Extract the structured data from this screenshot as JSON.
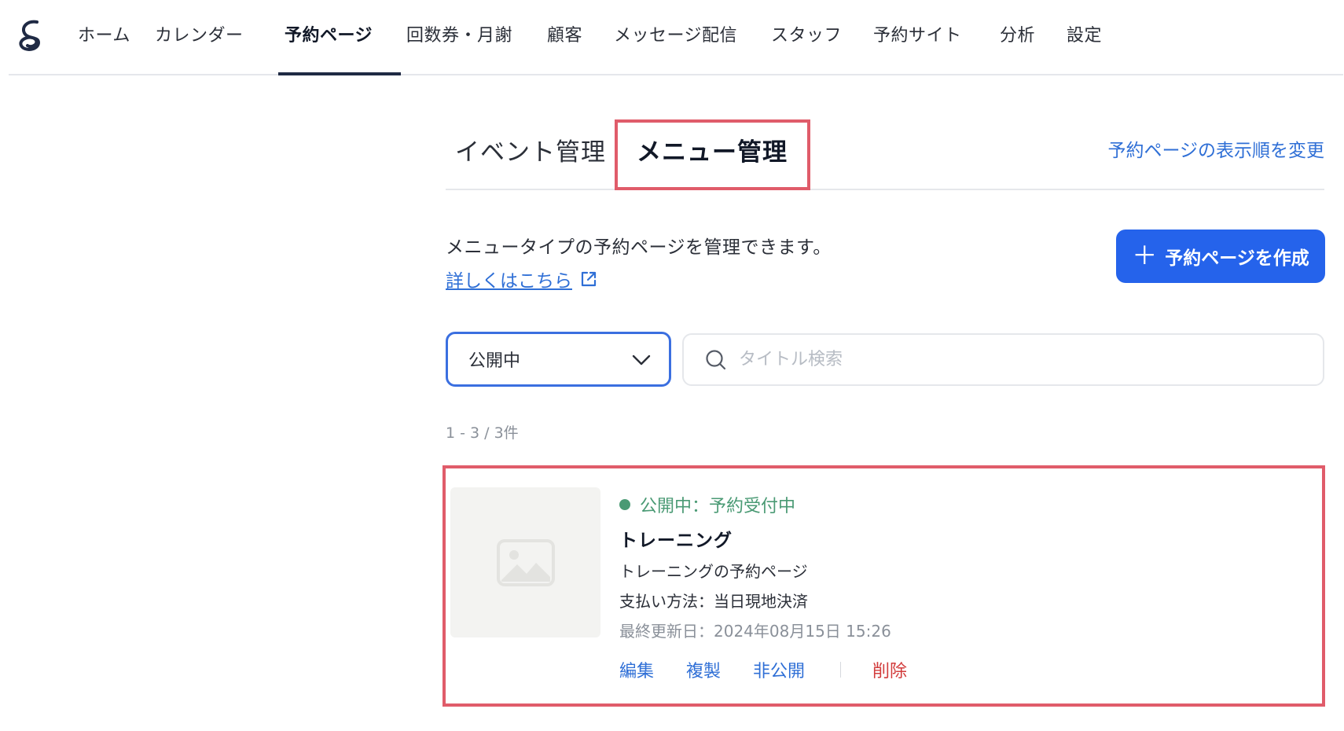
{
  "nav": {
    "items": [
      {
        "label": "ホーム"
      },
      {
        "label": "カレンダー"
      },
      {
        "label": "予約ページ",
        "active": true
      },
      {
        "label": "回数券・月謝"
      },
      {
        "label": "顧客"
      },
      {
        "label": "メッセージ配信"
      },
      {
        "label": "スタッフ"
      },
      {
        "label": "予約サイト"
      },
      {
        "label": "分析"
      },
      {
        "label": "設定"
      }
    ]
  },
  "subtabs": {
    "event": "イベント管理",
    "menu": "メニュー管理",
    "sort_link": "予約ページの表示順を変更"
  },
  "intro": {
    "description": "メニュータイプの予約ページを管理できます。",
    "detail_link": "詳しくはこちら",
    "create_button": "予約ページを作成"
  },
  "filters": {
    "status_selected": "公開中",
    "search_placeholder": "タイトル検索"
  },
  "result_count": "1 - 3 / 3件",
  "card": {
    "status": "公開中：予約受付中",
    "title": "トレーニング",
    "subtitle": "トレーニングの予約ページ",
    "payment": "支払い方法：当日現地決済",
    "updated": "最終更新日：2024年08月15日 15:26",
    "actions": {
      "edit": "編集",
      "duplicate": "複製",
      "unpublish": "非公開",
      "delete": "削除"
    }
  },
  "colors": {
    "accent": "#2563eb",
    "link": "#2f6fd6",
    "highlight": "#e05c6a",
    "status_green": "#4a9a74",
    "danger": "#d23b3b"
  }
}
